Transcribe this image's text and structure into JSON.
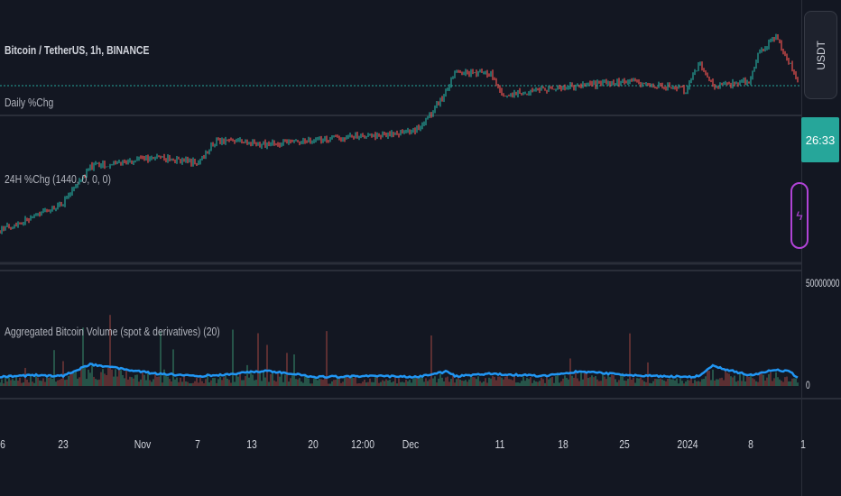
{
  "chart_data": {
    "type": "candlestick",
    "title": "Bitcoin / TetherUS, 1h, BINANCE",
    "indicators": [
      "Daily %Chg",
      "24H %Chg (1440, 0, 0, 0)",
      "Aggregated Bitcoin Volume (spot & derivatives) (20)"
    ],
    "price_path": [
      15,
      30,
      45,
      85,
      95,
      90,
      115,
      110,
      115,
      120,
      125,
      140,
      170,
      190,
      188,
      165,
      170,
      175,
      180,
      170,
      200,
      175,
      180,
      210,
      230,
      200,
      175
    ],
    "price_path_x": [
      0,
      40,
      70,
      100,
      170,
      220,
      240,
      295,
      350,
      420,
      460,
      475,
      495,
      505,
      545,
      555,
      600,
      640,
      700,
      760,
      775,
      790,
      830,
      840,
      860,
      875,
      885
    ],
    "volume_avg": [
      8,
      10,
      9,
      22,
      12,
      9,
      10,
      15,
      8,
      9,
      8,
      10,
      14,
      9,
      12,
      11,
      9,
      14,
      10,
      8,
      9,
      20,
      10,
      12,
      16,
      14,
      6
    ],
    "x_ticks": [
      "6",
      "23",
      "Nov",
      "7",
      "13",
      "20",
      "12:00",
      "Dec",
      "11",
      "18",
      "25",
      "2024",
      "8",
      "1"
    ],
    "volume_axis": {
      "top": "50000000",
      "bottom": "0"
    },
    "currency": "USDT",
    "countdown": "26:33",
    "colors": {
      "up": "#26a69a",
      "down": "#ef5350",
      "volume_line": "#2196f3",
      "hline": "#26a69a"
    }
  }
}
